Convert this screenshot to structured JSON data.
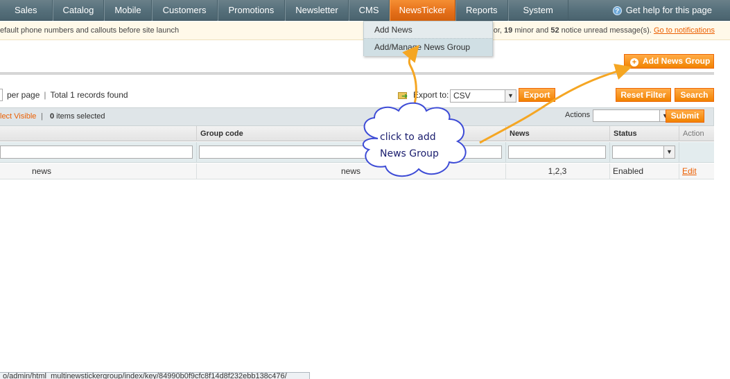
{
  "nav": {
    "items": [
      {
        "label": "Sales"
      },
      {
        "label": "Catalog"
      },
      {
        "label": "Mobile"
      },
      {
        "label": "Customers"
      },
      {
        "label": "Promotions"
      },
      {
        "label": "Newsletter"
      },
      {
        "label": "CMS"
      },
      {
        "label": "NewsTicker",
        "active": true
      },
      {
        "label": "Reports"
      },
      {
        "label": "System"
      }
    ],
    "help_label": "Get help for this page",
    "help_icon": "question-icon"
  },
  "notice": {
    "left_text": "efault phone numbers and callouts before site launch",
    "right_prefix": "ajor, ",
    "minor_count": "19",
    "minor_text": " minor and ",
    "notice_count": "52",
    "notice_text": " notice unread message(s). ",
    "link": "Go to notifications"
  },
  "dropdown": {
    "items": [
      {
        "label": "Add News"
      },
      {
        "label": "Add/Manage News Group"
      }
    ]
  },
  "toolbar": {
    "add_button": "Add News Group",
    "per_page": "per page",
    "separator": "|",
    "records": "Total 1 records found",
    "export_label": "Export to:",
    "export_format": "CSV",
    "export_button": "Export",
    "reset_button": "Reset Filter",
    "search_button": "Search"
  },
  "massaction": {
    "select_visible": "lect Visible",
    "separator": "|",
    "selected_count": "0",
    "selected_text": " items selected",
    "actions_label": "Actions",
    "submit_button": "Submit"
  },
  "grid": {
    "columns": [
      "Group code",
      "News",
      "Status",
      "Action"
    ],
    "rows": [
      {
        "title": "news",
        "group_code": "news",
        "news": "1,2,3",
        "status": "Enabled",
        "action": "Edit"
      }
    ]
  },
  "callout": {
    "line1": "click to add",
    "line2": "News Group"
  },
  "statusbar": {
    "url": "o/admin/html_multinewstickergroup/index/key/84990b0f9cfc8f14d8f232ebb138c476/"
  },
  "colors": {
    "accent": "#eb5e00",
    "nav_bg": "#56707b",
    "active_tab": "#e5701a",
    "callout_text": "#1a1d6e",
    "arrow": "#f5a623"
  }
}
